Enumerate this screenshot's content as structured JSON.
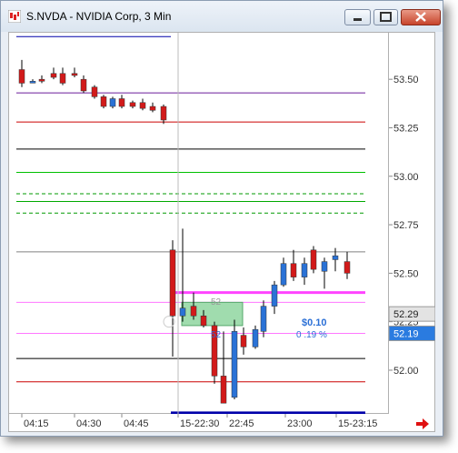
{
  "window": {
    "title": "S.NVDA - NVIDIA Corp, 3 Min",
    "accent": "#c7442c"
  },
  "chart_data": {
    "type": "candlestick",
    "ylim": [
      51.77,
      53.74
    ],
    "y_ticks": [
      "53.50",
      "53.25",
      "53.00",
      "52.75",
      "52.50",
      "52.25",
      "52.00"
    ],
    "x_ticks": [
      "04:15",
      "04:30",
      "04:45",
      "15-22:30",
      "22:45",
      "23:00",
      "15-23:15"
    ],
    "price_tags": [
      {
        "label": "52.29",
        "style": "gray"
      },
      {
        "label": "52.19",
        "style": "blue"
      }
    ],
    "annotations": {
      "zone_label_upper": "52",
      "zone_label_lower": "52",
      "change_amount": "$0.10",
      "change_percent": "0 .19 %"
    },
    "levels": [
      {
        "price": 53.72,
        "color": "#0000aa",
        "section": "pre"
      },
      {
        "price": 53.43,
        "color": "#6a1b9a",
        "section": "full"
      },
      {
        "price": 53.28,
        "color": "#cc0000",
        "section": "full"
      },
      {
        "price": 53.14,
        "color": "#000000",
        "section": "full"
      },
      {
        "price": 53.02,
        "color": "#00c000",
        "section": "full"
      },
      {
        "price": 52.91,
        "color": "#009900",
        "section": "full",
        "dash": true
      },
      {
        "price": 52.87,
        "color": "#00aa00",
        "section": "full"
      },
      {
        "price": 52.81,
        "color": "#009900",
        "section": "full",
        "dash": true
      },
      {
        "price": 52.61,
        "color": "#808080",
        "section": "full"
      },
      {
        "price": 52.4,
        "color": "#ff44ff",
        "section": "session"
      },
      {
        "price": 52.35,
        "color": "#ff77ff",
        "section": "full"
      },
      {
        "price": 52.19,
        "color": "#ff77ff",
        "section": "full"
      },
      {
        "price": 52.06,
        "color": "#000000",
        "section": "full"
      },
      {
        "price": 51.94,
        "color": "#cc0000",
        "section": "full"
      },
      {
        "price": 51.78,
        "color": "#0000aa",
        "section": "session"
      }
    ],
    "candles": [
      {
        "o": 53.55,
        "h": 53.6,
        "l": 53.46,
        "c": 53.48,
        "color": "red"
      },
      {
        "o": 53.49,
        "h": 53.5,
        "l": 53.48,
        "c": 53.49,
        "color": "blue"
      },
      {
        "o": 53.5,
        "h": 53.52,
        "l": 53.48,
        "c": 53.49,
        "color": "red"
      },
      {
        "o": 53.53,
        "h": 53.56,
        "l": 53.5,
        "c": 53.51,
        "color": "red"
      },
      {
        "o": 53.53,
        "h": 53.56,
        "l": 53.47,
        "c": 53.48,
        "color": "red"
      },
      {
        "o": 53.53,
        "h": 53.56,
        "l": 53.51,
        "c": 53.52,
        "color": "red"
      },
      {
        "o": 53.5,
        "h": 53.52,
        "l": 53.43,
        "c": 53.44,
        "color": "red"
      },
      {
        "o": 53.46,
        "h": 53.47,
        "l": 53.4,
        "c": 53.41,
        "color": "red"
      },
      {
        "o": 53.41,
        "h": 53.42,
        "l": 53.35,
        "c": 53.36,
        "color": "red"
      },
      {
        "o": 53.36,
        "h": 53.41,
        "l": 53.35,
        "c": 53.4,
        "color": "blue"
      },
      {
        "o": 53.4,
        "h": 53.42,
        "l": 53.35,
        "c": 53.36,
        "color": "red"
      },
      {
        "o": 53.38,
        "h": 53.39,
        "l": 53.35,
        "c": 53.36,
        "color": "red"
      },
      {
        "o": 53.38,
        "h": 53.4,
        "l": 53.34,
        "c": 53.35,
        "color": "red"
      },
      {
        "o": 53.36,
        "h": 53.38,
        "l": 53.33,
        "c": 53.34,
        "color": "red"
      },
      {
        "o": 53.36,
        "h": 53.37,
        "l": 53.27,
        "c": 53.29,
        "color": "red"
      },
      {
        "o": 52.62,
        "h": 52.67,
        "l": 52.07,
        "c": 52.28,
        "color": "red"
      },
      {
        "o": 52.28,
        "h": 52.73,
        "l": 52.25,
        "c": 52.32,
        "color": "blue"
      },
      {
        "o": 52.33,
        "h": 52.4,
        "l": 52.26,
        "c": 52.28,
        "color": "red"
      },
      {
        "o": 52.28,
        "h": 52.31,
        "l": 52.22,
        "c": 52.23,
        "color": "red"
      },
      {
        "o": 52.23,
        "h": 52.25,
        "l": 51.93,
        "c": 51.97,
        "color": "red"
      },
      {
        "o": 51.97,
        "h": 52.2,
        "l": 51.84,
        "c": 51.83,
        "color": "red"
      },
      {
        "o": 51.86,
        "h": 52.26,
        "l": 51.85,
        "c": 52.2,
        "color": "blue"
      },
      {
        "o": 52.18,
        "h": 52.22,
        "l": 52.08,
        "c": 52.12,
        "color": "red"
      },
      {
        "o": 52.12,
        "h": 52.23,
        "l": 52.11,
        "c": 52.21,
        "color": "blue"
      },
      {
        "o": 52.2,
        "h": 52.36,
        "l": 52.17,
        "c": 52.33,
        "color": "blue"
      },
      {
        "o": 52.33,
        "h": 52.46,
        "l": 52.29,
        "c": 52.44,
        "color": "blue"
      },
      {
        "o": 52.44,
        "h": 52.58,
        "l": 52.43,
        "c": 52.55,
        "color": "blue"
      },
      {
        "o": 52.55,
        "h": 52.62,
        "l": 52.46,
        "c": 52.48,
        "color": "red"
      },
      {
        "o": 52.48,
        "h": 52.58,
        "l": 52.44,
        "c": 52.55,
        "color": "blue"
      },
      {
        "o": 52.62,
        "h": 52.64,
        "l": 52.5,
        "c": 52.52,
        "color": "red"
      },
      {
        "o": 52.51,
        "h": 52.58,
        "l": 52.42,
        "c": 52.56,
        "color": "blue"
      },
      {
        "o": 52.57,
        "h": 52.63,
        "l": 52.51,
        "c": 52.59,
        "color": "blue"
      },
      {
        "o": 52.56,
        "h": 52.61,
        "l": 52.47,
        "c": 52.5,
        "color": "red"
      }
    ]
  }
}
